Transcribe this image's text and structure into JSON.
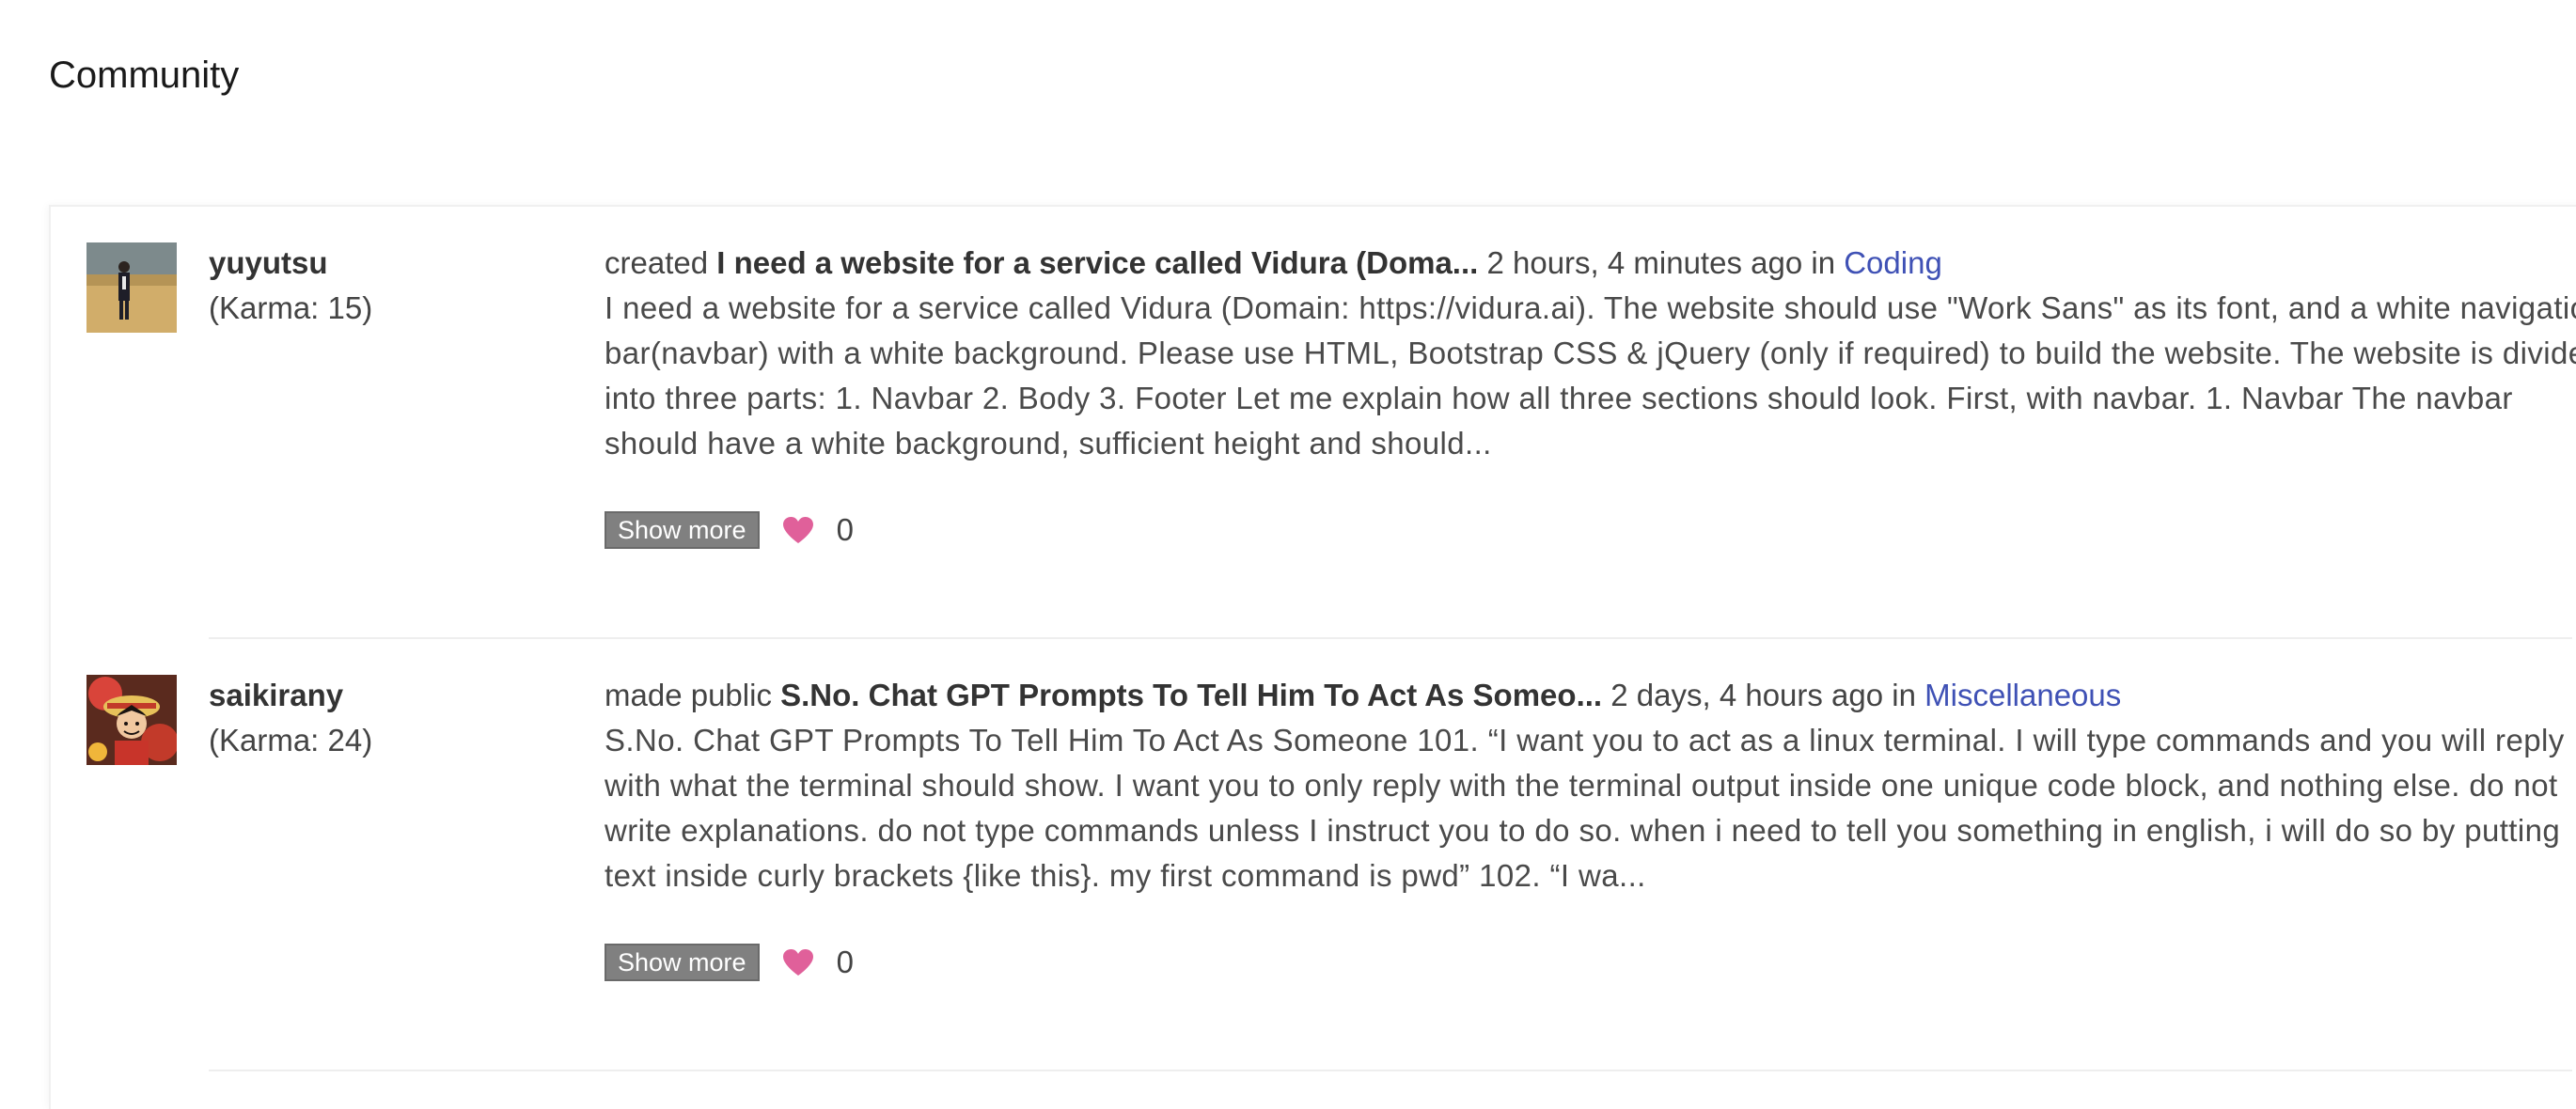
{
  "page": {
    "title": "Community"
  },
  "colors": {
    "link": "#3f51b5",
    "heart": "#e0609a",
    "button": "#808080"
  },
  "posts": [
    {
      "user": {
        "name": "yuyutsu",
        "karma": "(Karma: 15)",
        "avatar_icon": "avatar-person-standing"
      },
      "action": "created",
      "title": "I need a website for a service called Vidura (Doma...",
      "time": "2 hours, 4 minutes ago",
      "in_label": "in",
      "category": "Coding",
      "body": "I need a website for a service called Vidura (Domain: https://vidura.ai). The website should use \"Work Sans\" as its font, and a white navigation bar(navbar) with a white background. Please use HTML, Bootstrap CSS & jQuery (only if required) to build the website. The website is divided into three parts: 1. Navbar 2. Body 3. Footer Let me explain how all three sections should look. First, with navbar. 1. Navbar The navbar should have a white background, sufficient height and should...",
      "show_more": "Show more",
      "likes": "0"
    },
    {
      "user": {
        "name": "saikirany",
        "karma": "(Karma: 24)",
        "avatar_icon": "avatar-anime-character"
      },
      "action": "made public",
      "title": "S.No. Chat GPT Prompts To Tell Him To Act As Someo...",
      "time": "2 days, 4 hours ago",
      "in_label": "in",
      "category": "Miscellaneous",
      "body": "S.No. Chat GPT Prompts To Tell Him To Act As Someone 101. “I want you to act as a linux terminal. I will type commands and you will reply with what the terminal should show. I want you to only reply with the terminal output inside one unique code block, and nothing else. do not write explanations. do not type commands unless I instruct you to do so. when i need to tell you something in english, i will do so by putting text inside curly brackets {like this}. my first command is pwd” 102. “I wa...",
      "show_more": "Show more",
      "likes": "0"
    }
  ]
}
